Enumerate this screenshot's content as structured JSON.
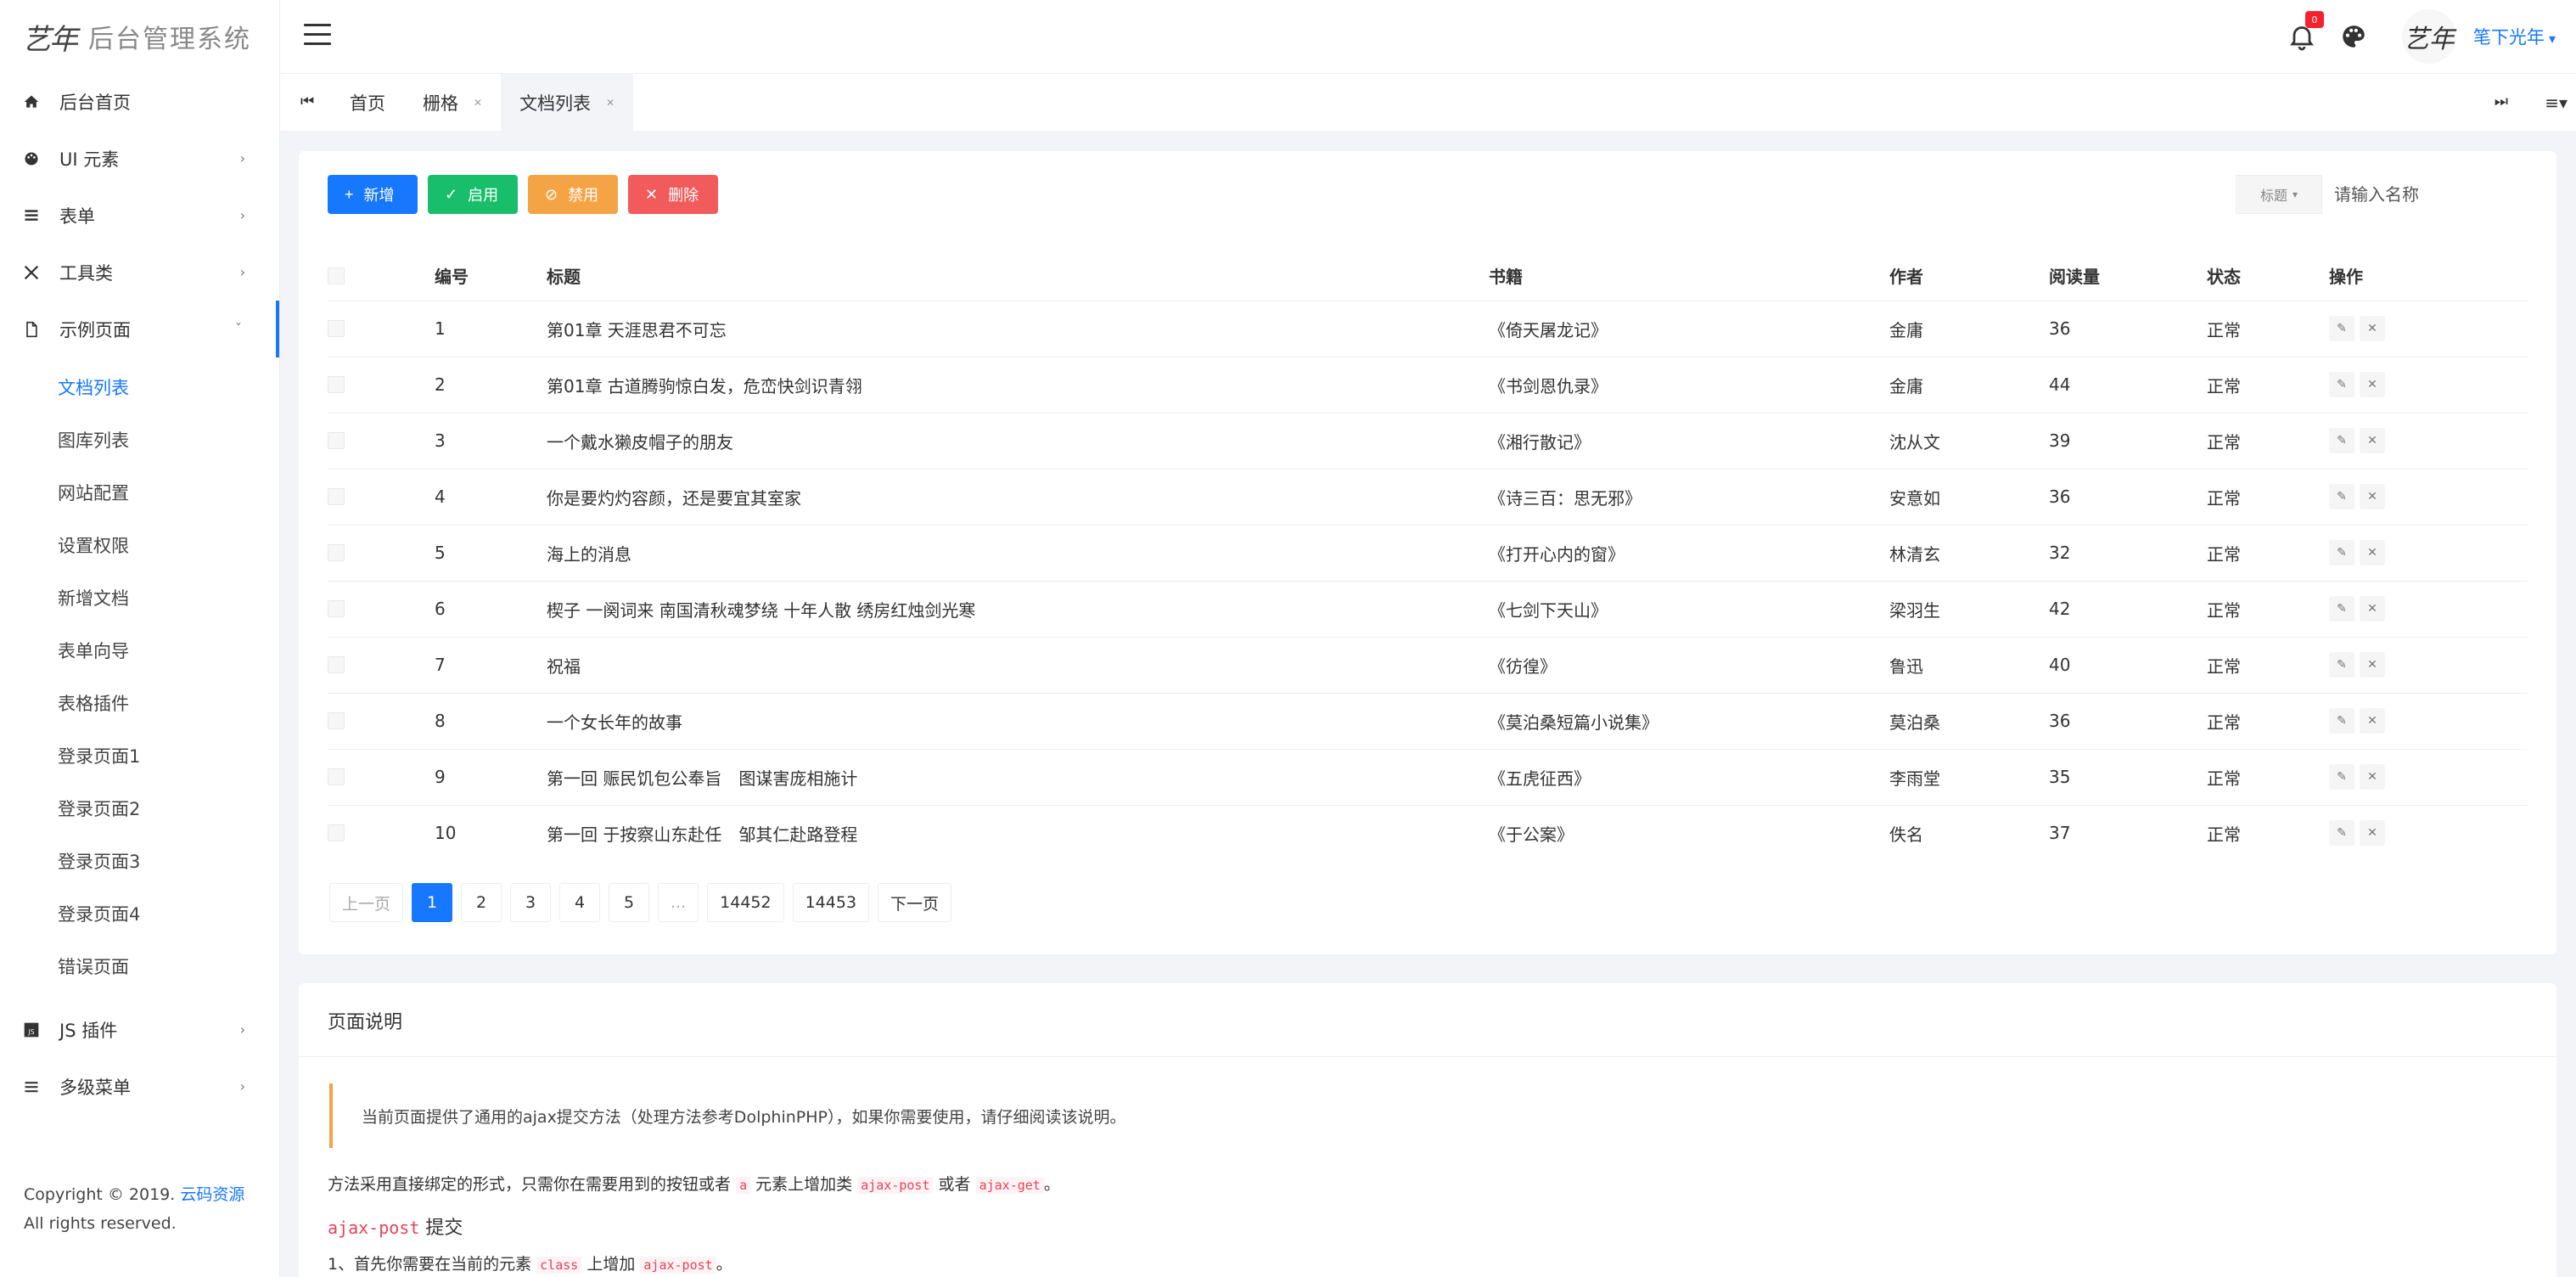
{
  "brand": {
    "logo": "艺年",
    "title": "后台管理系统"
  },
  "sidebar": {
    "items": [
      {
        "label": "后台首页",
        "icon": "home-icon",
        "chevron": false
      },
      {
        "label": "UI 元素",
        "icon": "palette-icon",
        "chevron": true
      },
      {
        "label": "表单",
        "icon": "list-icon",
        "chevron": true
      },
      {
        "label": "工具类",
        "icon": "tools-icon",
        "chevron": true
      },
      {
        "label": "示例页面",
        "icon": "file-icon",
        "chevron": true,
        "expanded": true
      }
    ],
    "sub_items": [
      {
        "label": "文档列表",
        "active": true
      },
      {
        "label": "图库列表"
      },
      {
        "label": "网站配置"
      },
      {
        "label": "设置权限"
      },
      {
        "label": "新增文档"
      },
      {
        "label": "表单向导"
      },
      {
        "label": "表格插件"
      },
      {
        "label": "登录页面1"
      },
      {
        "label": "登录页面2"
      },
      {
        "label": "登录页面3"
      },
      {
        "label": "登录页面4"
      },
      {
        "label": "错误页面"
      }
    ],
    "items_after": [
      {
        "label": "JS 插件",
        "icon": "js-icon",
        "chevron": true
      },
      {
        "label": "多级菜单",
        "icon": "menu-icon",
        "chevron": true
      }
    ],
    "copyright_prefix": "Copyright © 2019.",
    "copyright_link": "云码资源",
    "copyright_suffix": "All rights reserved."
  },
  "header": {
    "notification_count": "0",
    "username": "笔下光年",
    "avatar_text": "艺年"
  },
  "tabs": [
    {
      "label": "首页",
      "closable": false
    },
    {
      "label": "栅格",
      "closable": true
    },
    {
      "label": "文档列表",
      "closable": true,
      "active": true
    }
  ],
  "toolbar": {
    "new_label": "新增",
    "enable_label": "启用",
    "disable_label": "禁用",
    "delete_label": "删除"
  },
  "search": {
    "select_label": "标题",
    "placeholder": "请输入名称"
  },
  "table": {
    "columns": [
      "编号",
      "标题",
      "书籍",
      "作者",
      "阅读量",
      "状态",
      "操作"
    ],
    "rows": [
      {
        "id": "1",
        "title": "第01章 天涯思君不可忘",
        "book": "《倚天屠龙记》",
        "author": "金庸",
        "views": "36",
        "status": "正常"
      },
      {
        "id": "2",
        "title": "第01章 古道腾驹惊白发，危峦快剑识青翎",
        "book": "《书剑恩仇录》",
        "author": "金庸",
        "views": "44",
        "status": "正常"
      },
      {
        "id": "3",
        "title": "一个戴水獭皮帽子的朋友",
        "book": "《湘行散记》",
        "author": "沈从文",
        "views": "39",
        "status": "正常"
      },
      {
        "id": "4",
        "title": "你是要灼灼容颜，还是要宜其室家",
        "book": "《诗三百：思无邪》",
        "author": "安意如",
        "views": "36",
        "status": "正常"
      },
      {
        "id": "5",
        "title": "海上的消息",
        "book": "《打开心内的窗》",
        "author": "林清玄",
        "views": "32",
        "status": "正常"
      },
      {
        "id": "6",
        "title": "楔子 一阕词来 南国清秋魂梦绕 十年人散 绣房红烛剑光寒",
        "book": "《七剑下天山》",
        "author": "梁羽生",
        "views": "42",
        "status": "正常"
      },
      {
        "id": "7",
        "title": "祝福",
        "book": "《彷徨》",
        "author": "鲁迅",
        "views": "40",
        "status": "正常"
      },
      {
        "id": "8",
        "title": "一个女长年的故事",
        "book": "《莫泊桑短篇小说集》",
        "author": "莫泊桑",
        "views": "36",
        "status": "正常"
      },
      {
        "id": "9",
        "title": "第一回 赈民饥包公奉旨　图谋害庞相施计",
        "book": "《五虎征西》",
        "author": "李雨堂",
        "views": "35",
        "status": "正常"
      },
      {
        "id": "10",
        "title": "第一回 于按察山东赴任　邹其仁赴路登程",
        "book": "《于公案》",
        "author": "佚名",
        "views": "37",
        "status": "正常"
      }
    ]
  },
  "pager": {
    "prev": "上一页",
    "pages": [
      "1",
      "2",
      "3",
      "4",
      "5",
      "...",
      "14452",
      "14453"
    ],
    "next": "下一页",
    "current": "1"
  },
  "description": {
    "title": "页面说明",
    "callout": "当前页面提供了通用的ajax提交方法（处理方法参考DolphinPHP），如果你需要使用，请仔细阅读该说明。",
    "p1_a": "方法采用直接绑定的形式，只需你在需要用到的按钮或者",
    "p1_code1": "a",
    "p1_b": "元素上增加类",
    "p1_code2": "ajax-post",
    "p1_c": "或者",
    "p1_code3": "ajax-get",
    "p1_d": "。",
    "h_code": "ajax-post",
    "h_text": "提交",
    "p2_a": "1、首先你需要在当前的元素",
    "p2_code1": "class",
    "p2_b": "上增加",
    "p2_code2": "ajax-post",
    "p2_c": "。"
  },
  "colors": {
    "primary": "#1677ff",
    "success": "#19be6b",
    "warning": "#f5a445",
    "danger": "#f25b5b"
  }
}
